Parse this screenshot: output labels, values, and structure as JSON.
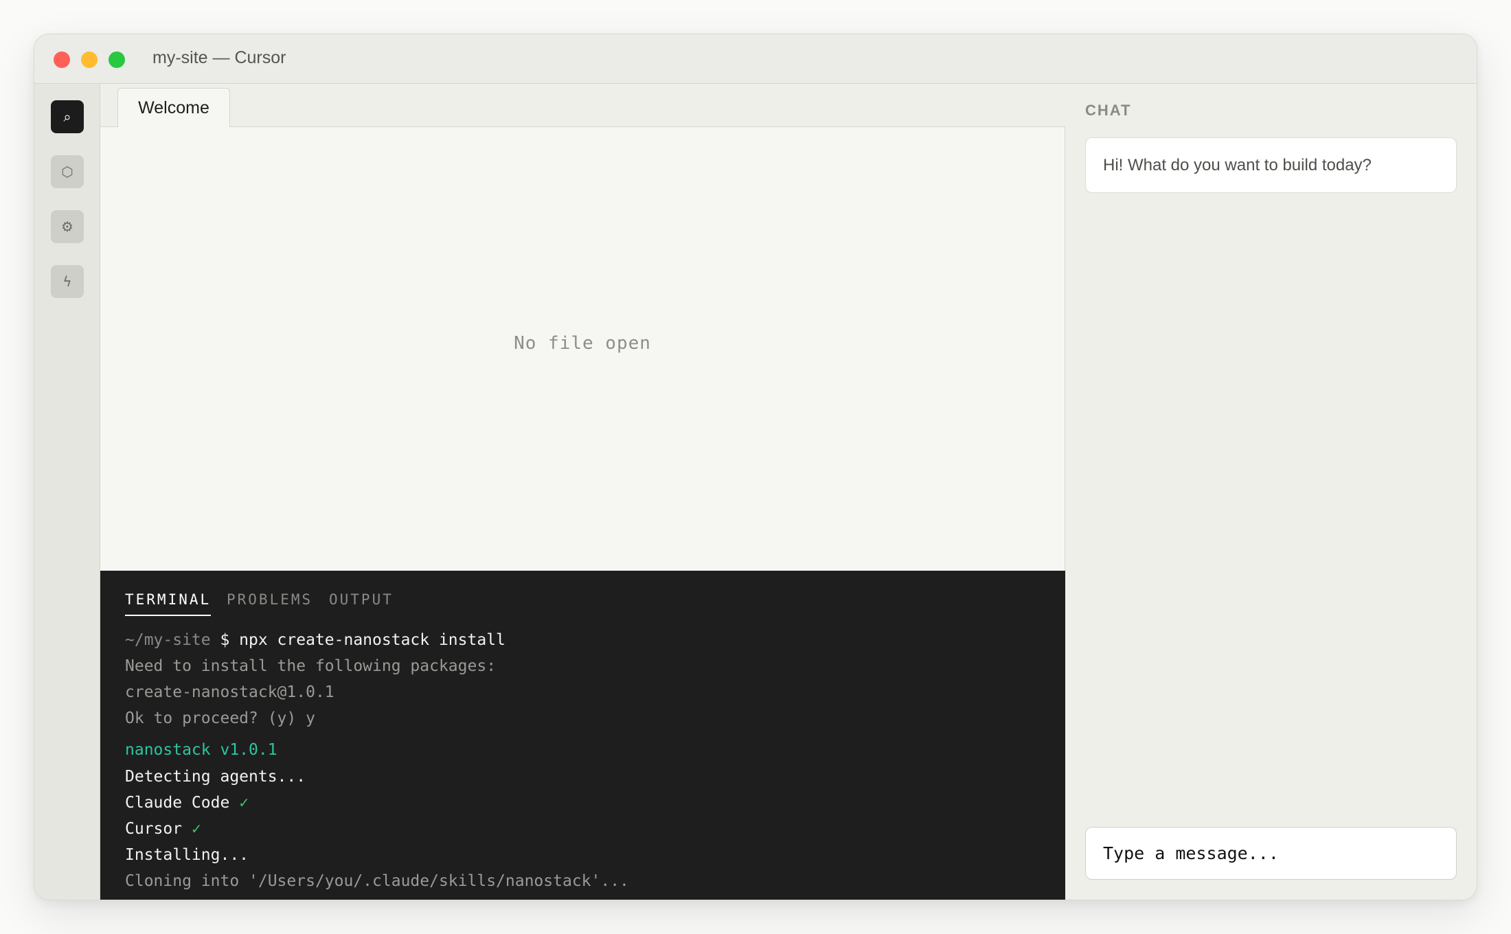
{
  "window": {
    "title": "my-site — Cursor"
  },
  "activity_bar": {
    "items": [
      {
        "icon": "search-icon",
        "glyph": "⌕",
        "active": true
      },
      {
        "icon": "hexagon-icon",
        "glyph": "⬡",
        "active": false
      },
      {
        "icon": "gear-icon",
        "glyph": "⚙",
        "active": false
      },
      {
        "icon": "bolt-icon",
        "glyph": "ϟ",
        "active": false
      }
    ]
  },
  "editor": {
    "tabs": [
      {
        "label": "Welcome"
      }
    ],
    "empty_message": "No file open"
  },
  "panel": {
    "tabs": [
      {
        "label": "TERMINAL",
        "active": true
      },
      {
        "label": "PROBLEMS",
        "active": false
      },
      {
        "label": "OUTPUT",
        "active": false
      }
    ],
    "terminal": {
      "prompt_path": "~/my-site",
      "command": " $ npx create-nanostack install",
      "lines": [
        "Need to install the following packages:",
        "create-nanostack@1.0.1",
        "Ok to proceed? (y) y",
        "nanostack v1.0.1",
        "Detecting agents...",
        "Claude Code",
        "Cursor",
        "Installing...",
        "Cloning into '/Users/you/.claude/skills/nanostack'..."
      ],
      "check_mark": "✓"
    }
  },
  "chat": {
    "heading": "CHAT",
    "greeting": "Hi! What do you want to build today?",
    "input_placeholder": "Type a message..."
  },
  "colors": {
    "accent_teal": "#2ec4a0",
    "check_green": "#3fbf5f",
    "terminal_bg": "#1e1e1e"
  }
}
